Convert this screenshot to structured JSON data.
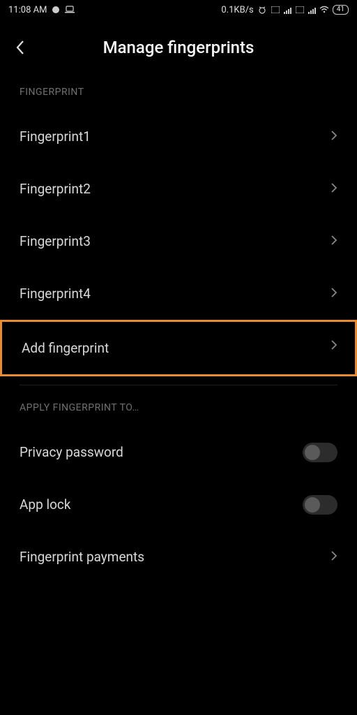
{
  "status_bar": {
    "time": "11:08 AM",
    "data_speed": "0.1KB/s",
    "battery": "41"
  },
  "header": {
    "title": "Manage fingerprints"
  },
  "sections": {
    "fingerprint": {
      "header": "FINGERPRINT",
      "items": [
        {
          "label": "Fingerprint1"
        },
        {
          "label": "Fingerprint2"
        },
        {
          "label": "Fingerprint3"
        },
        {
          "label": "Fingerprint4"
        }
      ],
      "add_label": "Add fingerprint"
    },
    "apply": {
      "header": "APPLY FINGERPRINT TO…",
      "privacy_password": "Privacy password",
      "app_lock": "App lock",
      "fingerprint_payments": "Fingerprint payments"
    }
  },
  "toggles": {
    "privacy_password": false,
    "app_lock": false
  },
  "highlight_color": "#e88a2e"
}
